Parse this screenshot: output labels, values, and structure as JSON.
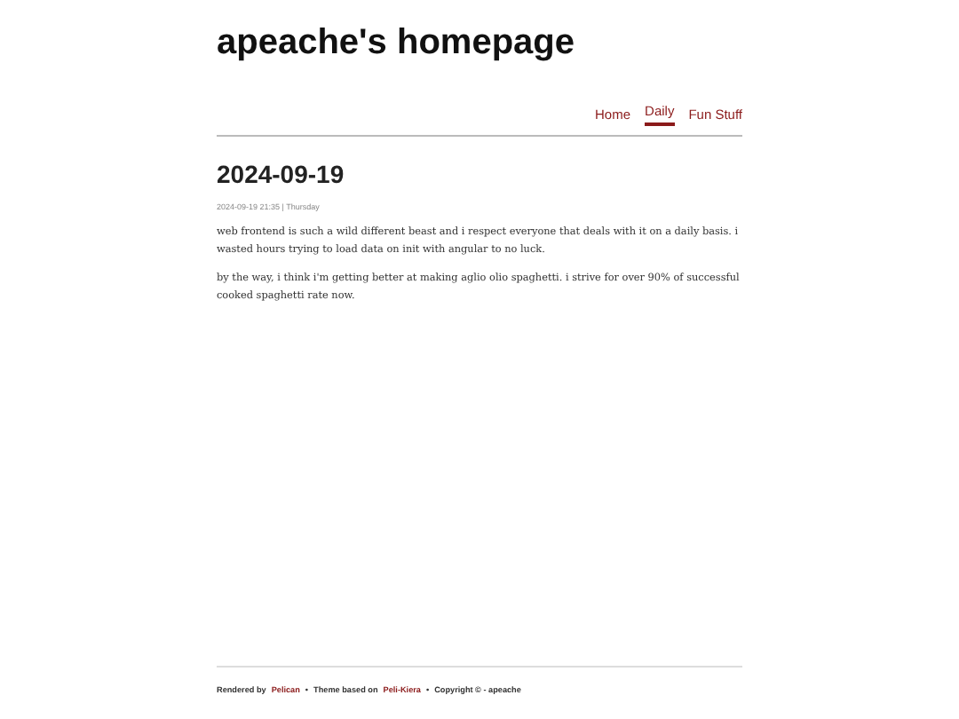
{
  "site_title": "apeache's homepage",
  "nav": [
    {
      "label": "Home",
      "selected": false
    },
    {
      "label": "Daily",
      "selected": true
    },
    {
      "label": "Fun Stuff",
      "selected": false
    }
  ],
  "post": {
    "title": "2024-09-19",
    "meta": "2024-09-19 21:35 | Thursday",
    "paragraphs": [
      "web frontend is such a wild different beast and i respect everyone that deals with it on a daily basis. i wasted hours trying to load data on init with angular to no luck.",
      "by the way, i think i'm getting better at making aglio olio spaghetti. i strive for over 90% of successful cooked spaghetti rate now."
    ]
  },
  "footer": [
    {
      "kind": "text",
      "text": "Rendered by"
    },
    {
      "kind": "link",
      "text": "Pelican"
    },
    {
      "kind": "text",
      "text": "•"
    },
    {
      "kind": "text",
      "text": "Theme based on"
    },
    {
      "kind": "link",
      "text": "Peli-Kiera"
    },
    {
      "kind": "text",
      "text": "•"
    },
    {
      "kind": "text",
      "text": "Copyright © - apeache"
    }
  ]
}
